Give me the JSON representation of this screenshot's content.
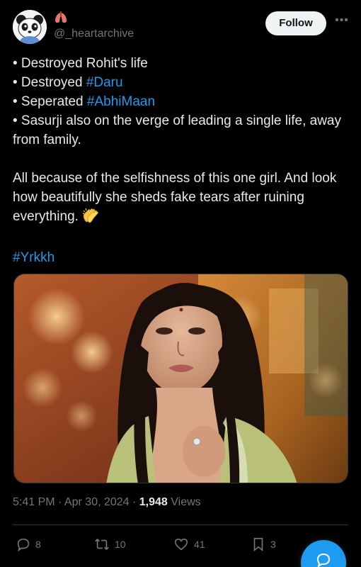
{
  "author": {
    "handle": "@_heartarchive",
    "avatar_icon": "panda-avatar",
    "name_icon": "lungs-icon"
  },
  "header": {
    "follow_label": "Follow",
    "more_icon": "more-dots-icon",
    "more_glyph": "•••"
  },
  "tweet": {
    "line1_text": "• Destroyed Rohit's life",
    "line2_prefix": "• Destroyed ",
    "line2_tag": "#Daru",
    "line3_prefix": "• Seperated ",
    "line3_tag": "#AbhiMaan",
    "line4_text": "• Sasurji also on the verge of leading a single life, away from family.",
    "para2_text": "All because of the selfishness of this one girl. And look how beautifully she sheds fake tears after ruining everything.",
    "para2_emoji": "clapping-hands-emoji",
    "hashtag": "#Yrkkh"
  },
  "meta": {
    "timestamp": "5:41 PM · Apr 30, 2024 ·",
    "views_count": "1,948",
    "views_label": "Views"
  },
  "actions": {
    "replies": "8",
    "reposts": "10",
    "likes": "41",
    "bookmarks": "3"
  },
  "colors": {
    "background": "#000000",
    "text": "#e7e9ea",
    "muted": "#71767b",
    "link": "#1d9bf0",
    "divider": "#2f3336"
  }
}
